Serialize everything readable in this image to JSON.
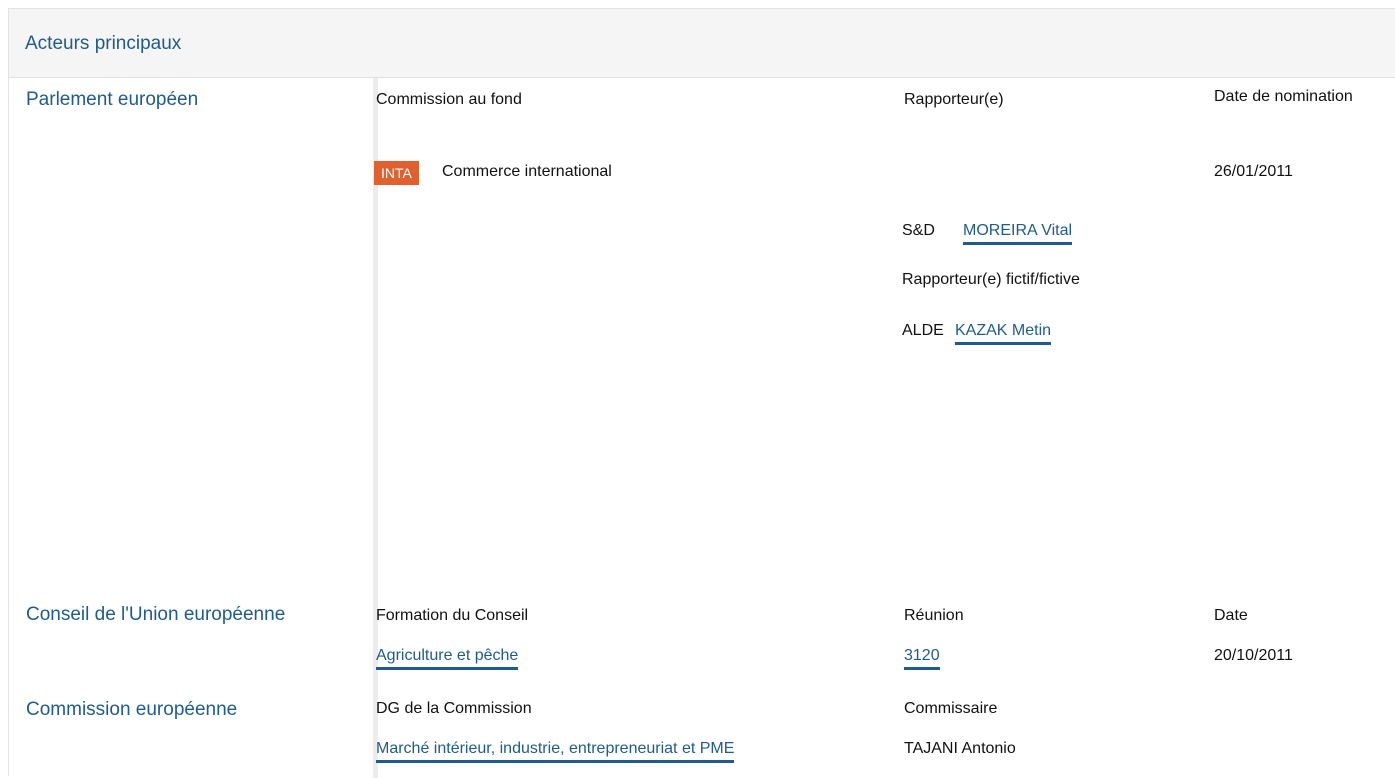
{
  "section": {
    "title": "Acteurs principaux"
  },
  "parliament": {
    "label": "Parlement européen",
    "headers": {
      "committee": "Commission au fond",
      "rapporteur": "Rapporteur(e)",
      "date": "Date de nomination"
    },
    "committee_badge": "INTA",
    "committee_name": "Commerce international",
    "appointment_date": "26/01/2011",
    "rapporteur": {
      "group": "S&D",
      "name": "MOREIRA Vital"
    },
    "shadow_label": "Rapporteur(e) fictif/fictive",
    "shadow": {
      "group": "ALDE",
      "name": "KAZAK Metin"
    }
  },
  "council": {
    "label": "Conseil de l'Union européenne",
    "headers": {
      "formation": "Formation du Conseil",
      "meeting": "Réunion",
      "date": "Date"
    },
    "formation": "Agriculture et pêche",
    "meeting": "3120",
    "date": "20/10/2011"
  },
  "commission": {
    "label": "Commission européenne",
    "headers": {
      "dg": "DG de la Commission",
      "commissioner": "Commissaire"
    },
    "dg": "Marché intérieur, industrie, entrepreneuriat et PME",
    "commissioner": "TAJANI Antonio"
  },
  "colors": {
    "link": "#1f5b8e",
    "badge": "#e06030",
    "header_bg": "#f5f5f5"
  }
}
